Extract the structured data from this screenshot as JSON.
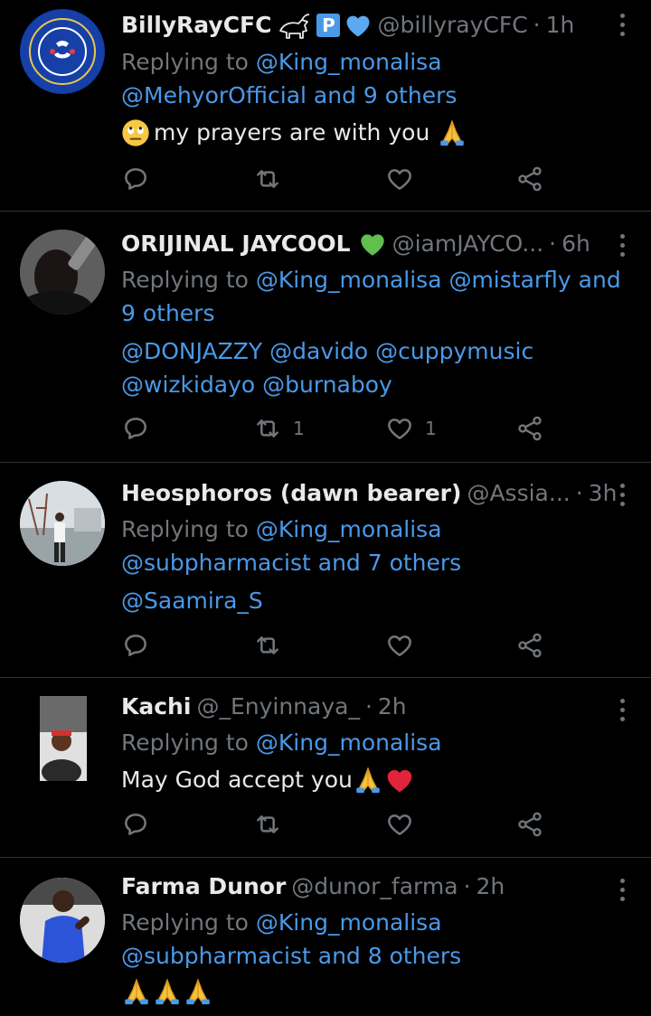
{
  "tweets": [
    {
      "name": "BillyRayCFC",
      "handle": "@billyrayCFC",
      "time": "1h",
      "replying_label": "Replying to",
      "mentions_line1": "@King_monalisa",
      "mentions_line2": "@MehyorOfficial and 9 others",
      "text": "my prayers are with you",
      "retweets": "",
      "likes": ""
    },
    {
      "name": "ORIJINAL JAYCOOL",
      "handle": "@iamJAYCO...",
      "time": "6h",
      "replying_label": "Replying to",
      "mentions_line1": "@King_monalisa @mistarfly and",
      "mentions_line2": "9 others",
      "text_line1": "@DONJAZZY @davido @cuppymusic",
      "text_line2": "@wizkidayo @burnaboy",
      "retweets": "1",
      "likes": "1"
    },
    {
      "name": "Heosphoros (dawn bearer)",
      "handle": "@Assia...",
      "time": "3h",
      "replying_label": "Replying to",
      "mentions_line1": "@King_monalisa",
      "mentions_line2": "@subpharmacist and 7 others",
      "text": "@Saamira_S",
      "retweets": "",
      "likes": ""
    },
    {
      "name": "Kachi",
      "handle": "@_Enyinnaya_",
      "time": "2h",
      "replying_label": "Replying to",
      "mentions_line1": "@King_monalisa",
      "text": "May God accept you",
      "retweets": "",
      "likes": ""
    },
    {
      "name": "Farma Dunor",
      "handle": "@dunor_farma",
      "time": "2h",
      "replying_label": "Replying to",
      "mentions_line1": "@King_monalisa",
      "mentions_line2": "@subpharmacist and 8 others",
      "text": ""
    }
  ],
  "separator": "·",
  "badges": {
    "tweet1_verified_p": "P"
  },
  "colors": {
    "background": "#000000",
    "text": "#e7e9ea",
    "muted": "#71767b",
    "link": "#4a99e9",
    "divider": "#2f3336"
  },
  "icons": [
    "more-icon",
    "reply-icon",
    "retweet-icon",
    "like-icon",
    "share-icon",
    "goat-emoji",
    "blue-heart-emoji",
    "green-heart-emoji",
    "praying-hands-emoji",
    "red-heart-emoji",
    "rolling-eyes-emoji"
  ]
}
